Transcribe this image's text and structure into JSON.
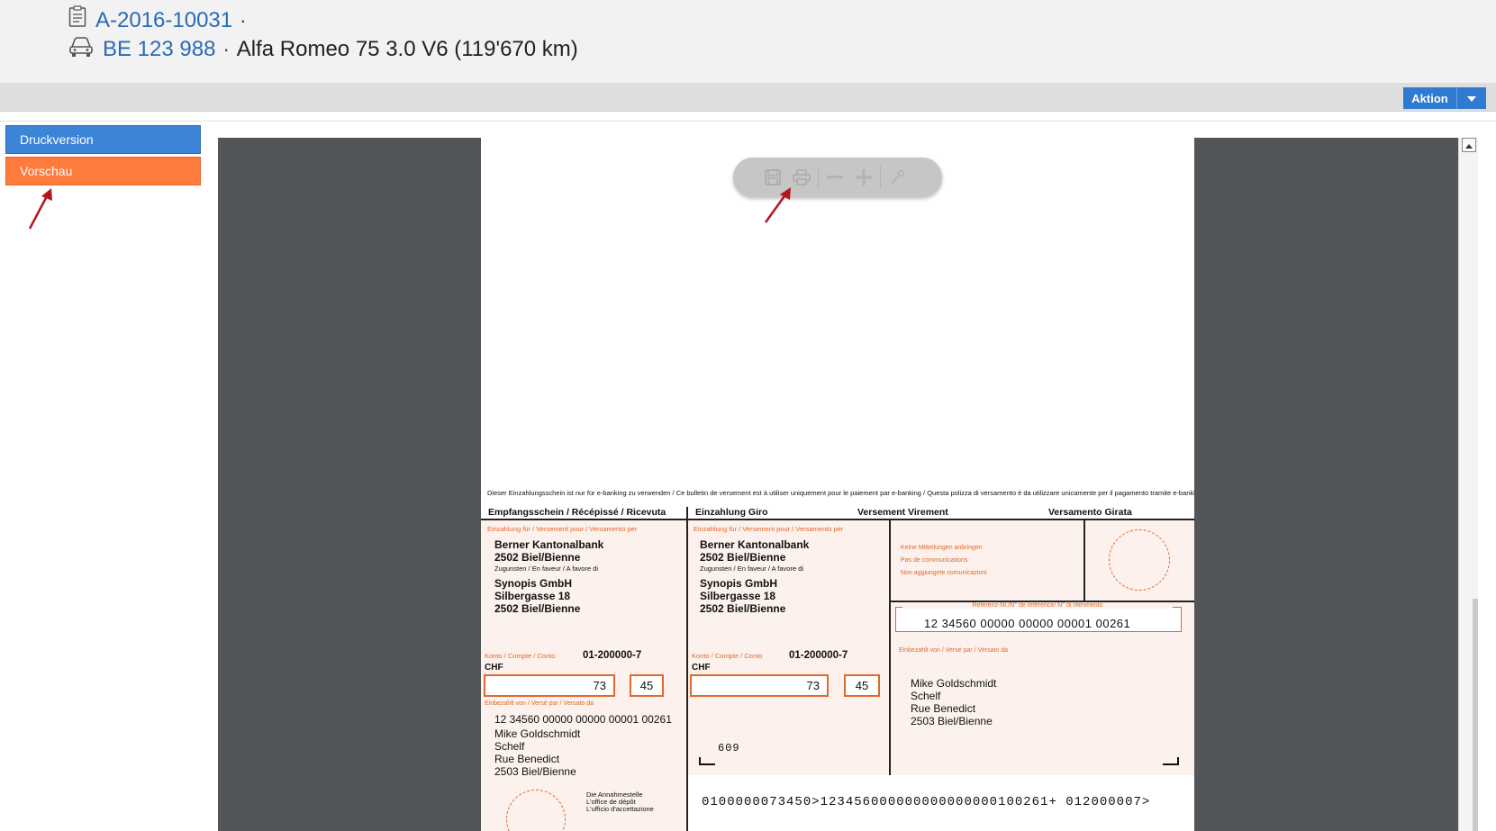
{
  "header": {
    "order_number": "A-2016-10031",
    "order_suffix": "·",
    "plate": "BE 123 988",
    "vehicle_sep": "·",
    "vehicle_desc": "Alfa Romeo 75 3.0 V6 (119'670 km)",
    "icons": [
      "clipboard-icon",
      "car-icon"
    ]
  },
  "actionbar": {
    "aktion_label": "Aktion"
  },
  "sidebar": {
    "items": [
      {
        "label": "Druckversion"
      },
      {
        "label": "Vorschau"
      }
    ]
  },
  "pdf_toolbar": {
    "icons": [
      "save-icon",
      "print-icon",
      "zoom-out-icon",
      "zoom-in-icon",
      "tools-icon"
    ]
  },
  "slip": {
    "notice": "Dieser Einzahlungsschein ist nur für e-banking zu verwenden / Ce bulletin de versement est à utiliser uniquement pour le paiement par e-banking / Questa polizza di versamento è da utilizzare unicamente per il pagamento tramite e-banking",
    "receipt_title": "Empfangsschein / Récépissé / Ricevuta",
    "giro_title": "Einzahlung Giro",
    "versement_title": "Versement  Virement",
    "versamento_title": "Versamento  Girata",
    "payment_for": "Einzahlung für / Versement pour / Versamento per",
    "bank_name": "Berner Kantonalbank",
    "bank_city": "2502 Biel/Bienne",
    "in_favour": "Zugunsten / En faveur / A favore di",
    "beneficiary_name": "Synopis GmbH",
    "beneficiary_street": "Silbergasse 18",
    "beneficiary_city": "2502 Biel/Bienne",
    "account_label": "Konto / Compte / Conto",
    "account_number": "01-200000-7",
    "currency": "CHF",
    "amount_francs": "73",
    "amount_cents": "45",
    "paid_by": "Einbezahlt von / Versé par / Versato da",
    "reference_short": "12 34560 00000 00000 00001 00261",
    "payer_name": "Mike Goldschmidt",
    "payer_line2": "Schelf",
    "payer_street": "Rue Benedict",
    "payer_city": "2503 Biel/Bienne",
    "no_messages_de": "Keine Mitteilungen anbringen",
    "no_messages_fr": "Pas de communications",
    "no_messages_it": "Non aggiungete comunicazioni",
    "reference_label": "Referenz-Nr./N° de référence/ N° di riferimento",
    "reference_number": "12  34560  00000  00000  00001  00261",
    "code_609": "609",
    "acceptance_de": "Die Annahmestelle",
    "acceptance_fr": "L'office de dépôt",
    "acceptance_it": "L'ufficio d'accettazione",
    "coding_line": "0100000073450>123456000000000000000100261+ 012000007>"
  },
  "colors": {
    "accent_blue": "#3b84d8",
    "accent_orange": "#ff7a3d",
    "slip_orange": "#e0692c",
    "link_blue": "#2a6bb5"
  }
}
